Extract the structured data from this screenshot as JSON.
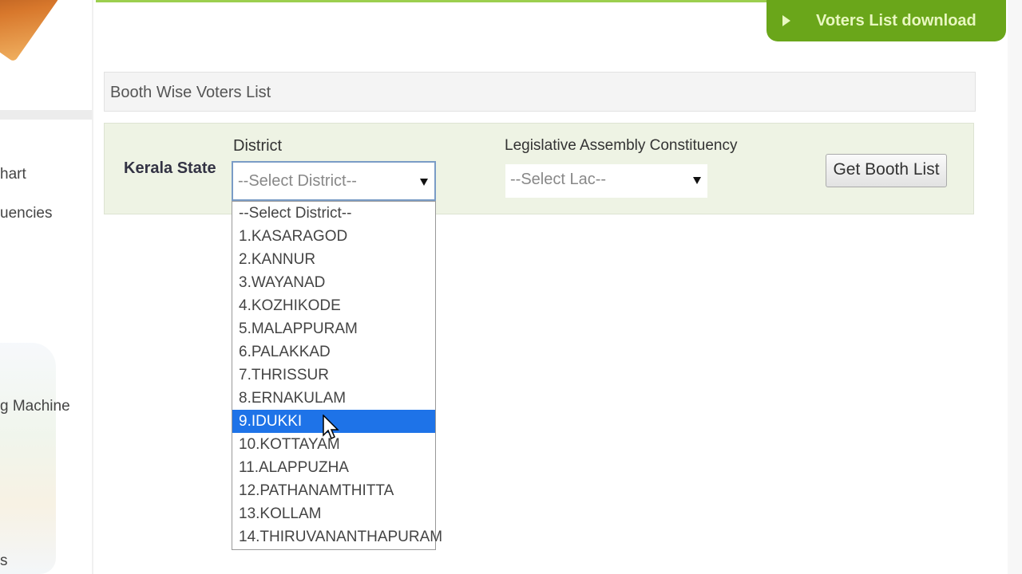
{
  "sidebar": {
    "items": [
      "hart",
      "uencies",
      "g Machine",
      "s"
    ]
  },
  "download_button": {
    "label": "Voters List download",
    "icon": "play-triangle-icon",
    "color": "#6aa61a"
  },
  "section": {
    "title": "Booth Wise Voters List"
  },
  "form": {
    "state_label": "Kerala State",
    "district_label": "District",
    "district_value": "--Select District--",
    "lac_label": "Legislative Assembly Constituency",
    "lac_value": "--Select Lac--",
    "submit_label": "Get Booth List"
  },
  "district_options": [
    "--Select District--",
    "1.KASARAGOD",
    "2.KANNUR",
    "3.WAYANAD",
    "4.KOZHIKODE",
    "5.MALAPPURAM",
    "6.PALAKKAD",
    "7.THRISSUR",
    "8.ERNAKULAM",
    "9.IDUKKI",
    "10.KOTTAYAM",
    "11.ALAPPUZHA",
    "12.PATHANAMTHITTA",
    "13.KOLLAM",
    "14.THIRUVANANTHAPURAM"
  ],
  "highlighted_option": "9.IDUKKI",
  "highlight_color": "#1e73e8"
}
